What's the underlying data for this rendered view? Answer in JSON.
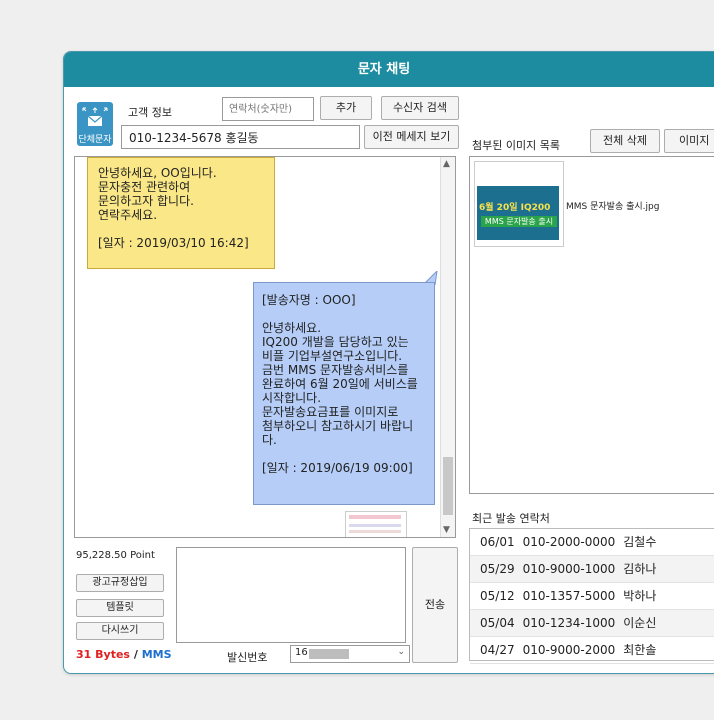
{
  "window": {
    "title": "문자 채팅"
  },
  "customer": {
    "icon_label": "단체문자",
    "label": "고객 정보",
    "contact_placeholder": "연락처(숫자만)",
    "add_label": "추가",
    "search_label": "수신자 검색",
    "phone": "010-1234-5678  홍길동",
    "prev_label": "이전 메세지 보기"
  },
  "messages": {
    "incoming": {
      "lines": [
        "안녕하세요, OO입니다.",
        "문자충전 관련하여",
        "문의하고자 합니다.",
        "연락주세요.",
        "",
        "[일자 : 2019/03/10 16:42]"
      ]
    },
    "outgoing": {
      "text": "[발송자명 : OOO]\n\n안녕하세요.\nIQ200 개발을 담당하고 있는\n비플 기업부설연구소입니다.\n금번 MMS 문자발송서비스를\n완료하여 6월 20일에 서비스를\n시작합니다.\n문자발송요금표를 이미지로\n첨부하오니 참고하시기 바랍니\n다.\n\n[일자 : 2019/06/19 09:00]"
    }
  },
  "attachments": {
    "label": "첨부된 이미지 목록",
    "delete_all_label": "전체 삭제",
    "image_label": "이미지",
    "items": [
      {
        "filename": "MMS 문자발송 출시.jpg",
        "thumb_line1": "6월 20일 IQ200",
        "thumb_line2": "MMS 문자발송 출시"
      }
    ]
  },
  "compose": {
    "points": "95,228.50 Point",
    "ad_rule_label": "광고규정삽입",
    "template_label": "템플릿",
    "rewrite_label": "다시쓰기",
    "send_label": "전송",
    "bytes_text": "31 Bytes",
    "separator": "/",
    "mode": "MMS",
    "sender_label": "발신번호",
    "sender_value": "16"
  },
  "recent": {
    "label": "최근 발송 연락처",
    "rows": [
      {
        "date": "06/01",
        "phone": "010-2000-0000",
        "name": "김철수"
      },
      {
        "date": "05/29",
        "phone": "010-9000-1000",
        "name": "김하나"
      },
      {
        "date": "05/12",
        "phone": "010-1357-5000",
        "name": "박하나"
      },
      {
        "date": "05/04",
        "phone": "010-1234-1000",
        "name": "이순신"
      },
      {
        "date": "04/27",
        "phone": "010-9000-2000",
        "name": "최한솔"
      }
    ]
  },
  "colors": {
    "header": "#1d8ba0",
    "incoming_bubble": "#fae888",
    "outgoing_bubble": "#b5cdf7",
    "bytes": "#e02020",
    "mms": "#1d6fcf"
  }
}
